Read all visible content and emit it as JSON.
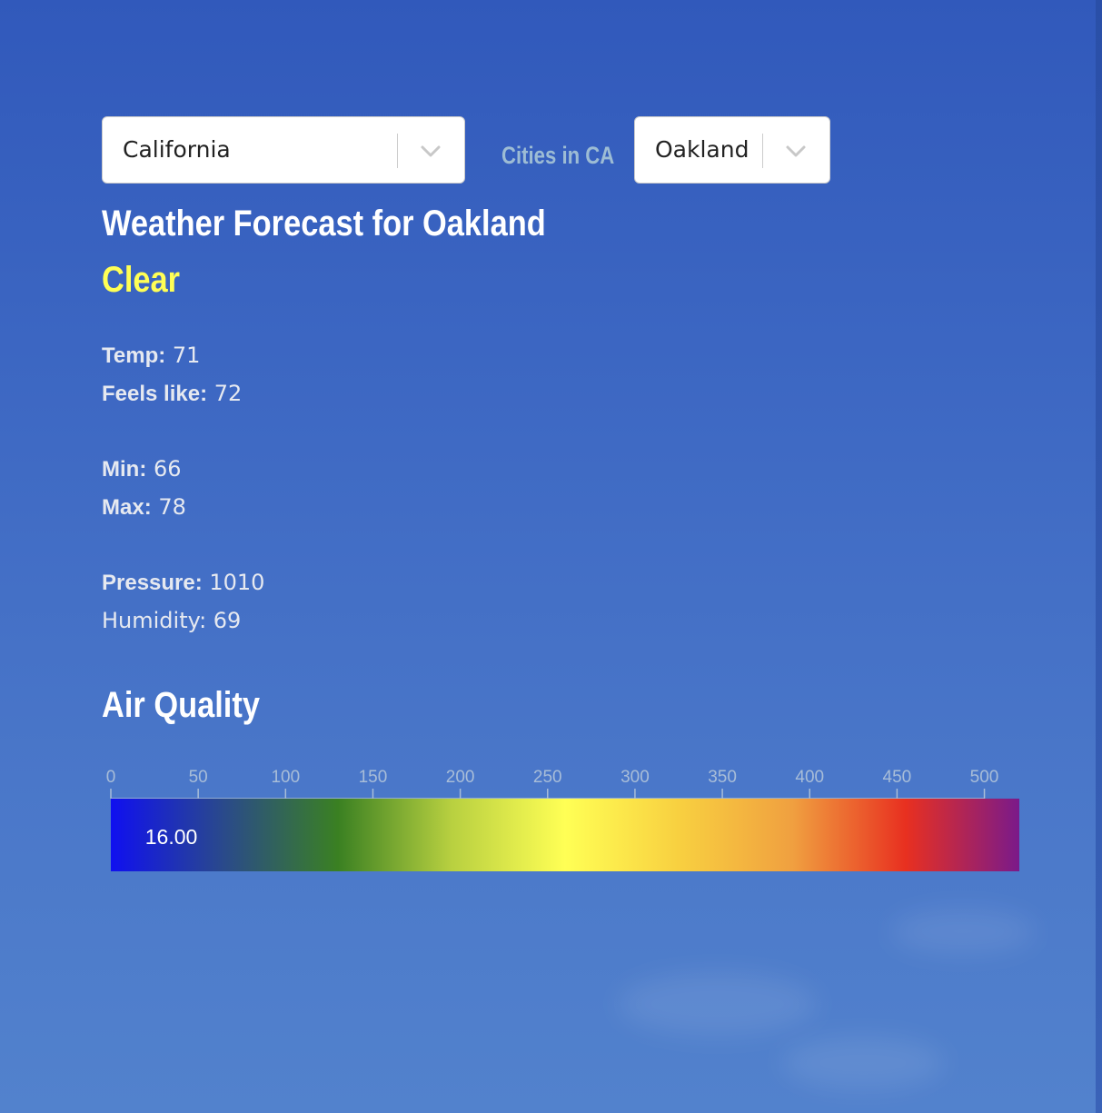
{
  "state_select": {
    "value": "California"
  },
  "cities_label": "Cities in CA",
  "city_select": {
    "value": "Oakland"
  },
  "forecast": {
    "title": "Weather Forecast for Oakland",
    "condition": "Clear",
    "condition_color": "#ffff55",
    "temp_label": "Temp:",
    "temp": "71",
    "feels_like_label": "Feels like:",
    "feels_like": "72",
    "min_label": "Min:",
    "min": "66",
    "max_label": "Max:",
    "max": "78",
    "pressure_label": "Pressure:",
    "pressure": "1010",
    "humidity_text": "Humidity: 69"
  },
  "air_quality": {
    "title": "Air Quality",
    "value_label": "16.00",
    "chart_data": {
      "type": "gradient-scale",
      "ticks": [
        0,
        50,
        100,
        150,
        200,
        250,
        300,
        350,
        400,
        450,
        500
      ],
      "domain": [
        0,
        520
      ],
      "value": 16.0,
      "gradient_colors": [
        "#1010f0",
        "#2a4a8a",
        "#3a8022",
        "#b8d040",
        "#ffff55",
        "#f8d040",
        "#f0a040",
        "#e83020",
        "#7a1a8a"
      ]
    }
  },
  "icons": {
    "state_dropdown": "chevron-down-icon",
    "city_dropdown": "chevron-down-icon"
  }
}
